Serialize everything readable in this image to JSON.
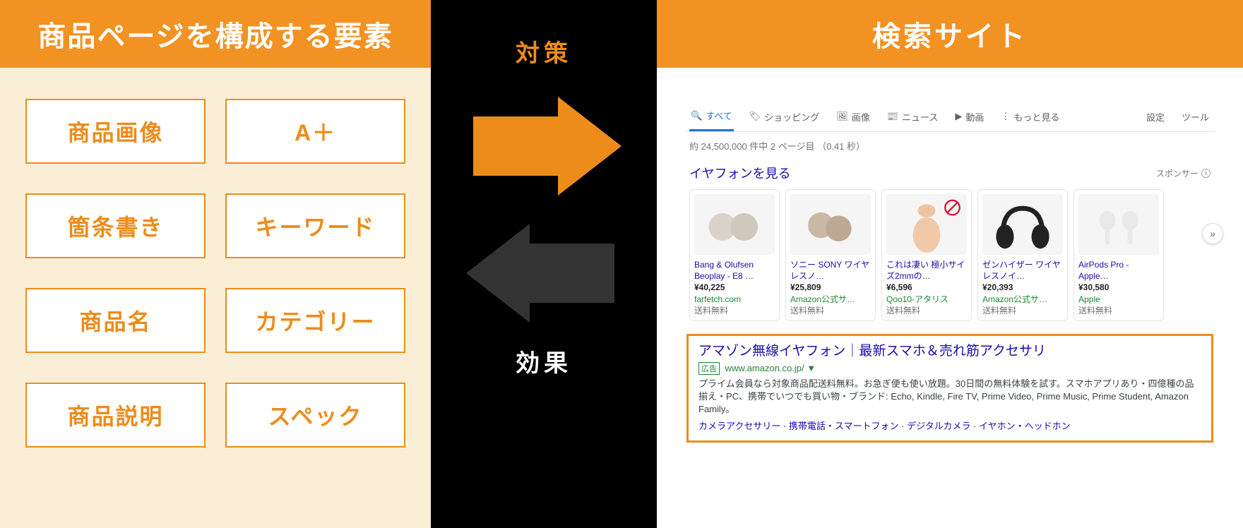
{
  "left": {
    "title": "商品ページを構成する要素",
    "elements": [
      "商品画像",
      "A＋",
      "箇条書き",
      "キーワード",
      "商品名",
      "カテゴリー",
      "商品説明",
      "スペック"
    ]
  },
  "center": {
    "top_label": "対策",
    "bottom_label": "効果"
  },
  "right": {
    "title": "検索サイト",
    "serp": {
      "tabs": [
        "すべて",
        "ショッピング",
        "画像",
        "ニュース",
        "動画",
        "もっと見る",
        "設定",
        "ツール"
      ],
      "stats": "約 24,500,000 件中 2 ページ目 （0.41 秒）",
      "shopping_heading": "イヤフォンを見る",
      "sponsor_label": "スポンサー",
      "more_glyph": "»",
      "products": [
        {
          "title": "Bang & Olufsen Beoplay - E8 …",
          "price": "¥40,225",
          "store": "farfetch.com",
          "ship": "送料無料"
        },
        {
          "title": "ソニー SONY ワイヤレスノ…",
          "price": "¥25,809",
          "store": "Amazon公式サ…",
          "ship": "送料無料"
        },
        {
          "title": "これは凄い 極小サイズ2mmの…",
          "price": "¥6,596",
          "store": "Qoo10-アタリス",
          "ship": "送料無料"
        },
        {
          "title": "ゼンハイザー ワイヤレスノイ…",
          "price": "¥20,393",
          "store": "Amazon公式サ…",
          "ship": "送料無料"
        },
        {
          "title": "AirPods Pro - Apple…",
          "price": "¥30,580",
          "store": "Apple",
          "ship": "送料無料"
        }
      ],
      "ad": {
        "title": "アマゾン無線イヤフォン｜最新スマホ＆売れ筋アクセサリ",
        "badge": "広告",
        "url": "www.amazon.co.jp/",
        "desc": "プライム会員なら対象商品配送料無料。お急ぎ便も使い放題。30日間の無料体験を試す。スマホアプリあり・四億種の品揃え・PC、携帯でいつでも買い物・ブランド: Echo, Kindle, Fire TV, Prime Video, Prime Music, Prime Student, Amazon Family。",
        "links": "カメラアクセサリー · 携帯電話・スマートフォン · デジタルカメラ · イヤホン・ヘッドホン"
      }
    }
  }
}
